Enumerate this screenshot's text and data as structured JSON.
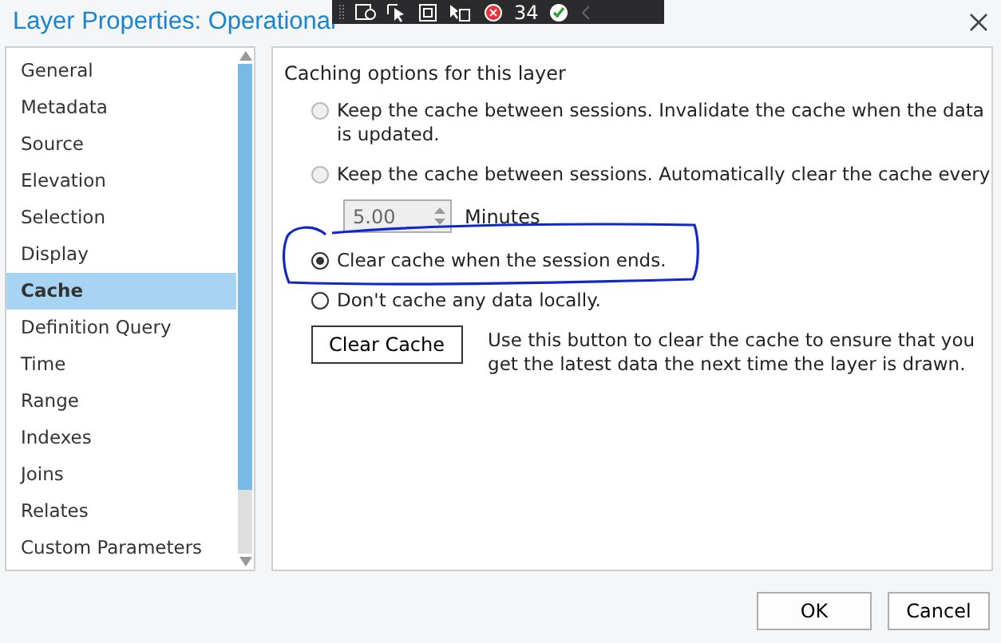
{
  "window": {
    "title": "Layer Properties: Operational"
  },
  "overlay_toolbar": {
    "error_count": "34"
  },
  "sidebar": {
    "items": [
      {
        "label": "General",
        "selected": false
      },
      {
        "label": "Metadata",
        "selected": false
      },
      {
        "label": "Source",
        "selected": false
      },
      {
        "label": "Elevation",
        "selected": false
      },
      {
        "label": "Selection",
        "selected": false
      },
      {
        "label": "Display",
        "selected": false
      },
      {
        "label": "Cache",
        "selected": true
      },
      {
        "label": "Definition Query",
        "selected": false
      },
      {
        "label": "Time",
        "selected": false
      },
      {
        "label": "Range",
        "selected": false
      },
      {
        "label": "Indexes",
        "selected": false
      },
      {
        "label": "Joins",
        "selected": false
      },
      {
        "label": "Relates",
        "selected": false
      },
      {
        "label": "Custom Parameters",
        "selected": false
      }
    ]
  },
  "panel": {
    "heading": "Caching options for this layer",
    "options": [
      {
        "label": "Keep the cache between sessions. Invalidate the cache when the data is updated.",
        "selected": false,
        "disabled": true
      },
      {
        "label": "Keep the cache between sessions. Automatically clear the cache every",
        "selected": false,
        "disabled": true
      },
      {
        "label": "Clear cache when the session ends.",
        "selected": true,
        "disabled": false,
        "annotated": true
      },
      {
        "label": "Don't cache any data locally.",
        "selected": false,
        "disabled": false
      }
    ],
    "interval": {
      "value": "5.00",
      "unit": "Minutes",
      "disabled": true
    },
    "clear_button": "Clear Cache",
    "clear_note": "Use this button to clear the cache to ensure that you get the latest data the next time the layer is drawn."
  },
  "buttons": [
    "OK",
    "Cancel"
  ]
}
